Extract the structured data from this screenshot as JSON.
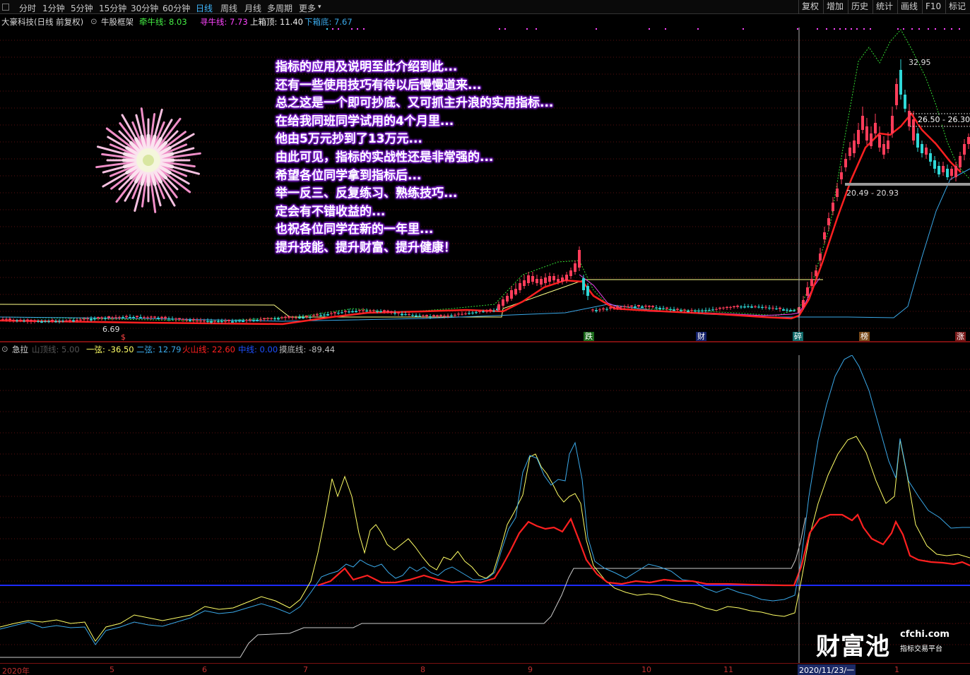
{
  "toolbar": {
    "periods": [
      "分时",
      "1分钟",
      "5分钟",
      "15分钟",
      "30分钟",
      "60分钟",
      "日线",
      "周线",
      "月线",
      "多周期",
      "更多"
    ],
    "active_period": "日线",
    "tools": [
      "复权",
      "增加",
      "历史",
      "统计",
      "画线",
      "F10",
      "标记"
    ]
  },
  "main_info": {
    "stock_name": "大豪科技(日线 前复权)",
    "indicator": "牛股框架",
    "qianniu": "牵牛线: 8.03",
    "xunniu": "寻牛线: 7.73",
    "upper_box": "上箱顶: 11.40",
    "lower_box": "下箱底: 7.67"
  },
  "overlay_text": [
    "指标的应用及说明至此介绍到此...",
    "还有一些使用技巧有待以后慢慢道来...",
    "总之这是一个即可抄底、又可抓主升浪的实用指标...",
    "在给我同班同学试用的4个月里...",
    "他由5万元抄到了13万元...",
    "由此可见，指标的实战性还是非常强的...",
    "希望各位同学拿到指标后...",
    "举一反三、反复练习、熟练技巧...",
    "定会有不错收益的...",
    "也祝各位同学在新的一年里...",
    "提升技能、提升财富、提升健康！"
  ],
  "price_labels": {
    "high": "32.95",
    "resistance": "26.50 - 26.30",
    "support": "20.49 - 20.93",
    "low": "6.69"
  },
  "markers": [
    "$",
    "跌",
    "财",
    "碎",
    "榜",
    "涨"
  ],
  "sub_info": {
    "name": "急拉",
    "l1": "山顶线: 5.00",
    "l2": "一弦: -36.50",
    "l3": "二弦: 12.79",
    "l4": "火山线: 22.60",
    "l5": "中线: 0.00",
    "l6": "摸底线: -89.44"
  },
  "xaxis": {
    "labels": [
      "2020年",
      "5",
      "6",
      "7",
      "8",
      "9",
      "10",
      "11",
      "1"
    ],
    "cursor_date": "2020/11/23/一"
  },
  "logo": {
    "name": "财富池",
    "domain": "cfchi.com",
    "tagline": "指标交易平台"
  },
  "colors": {
    "up": "#ff3d5a",
    "down": "#2fd8d8",
    "ma_red": "#ff2020",
    "ma_yellow": "#ffff66",
    "ma_cyan": "#3aa8e8",
    "mid_line": "#1e2aff"
  }
}
